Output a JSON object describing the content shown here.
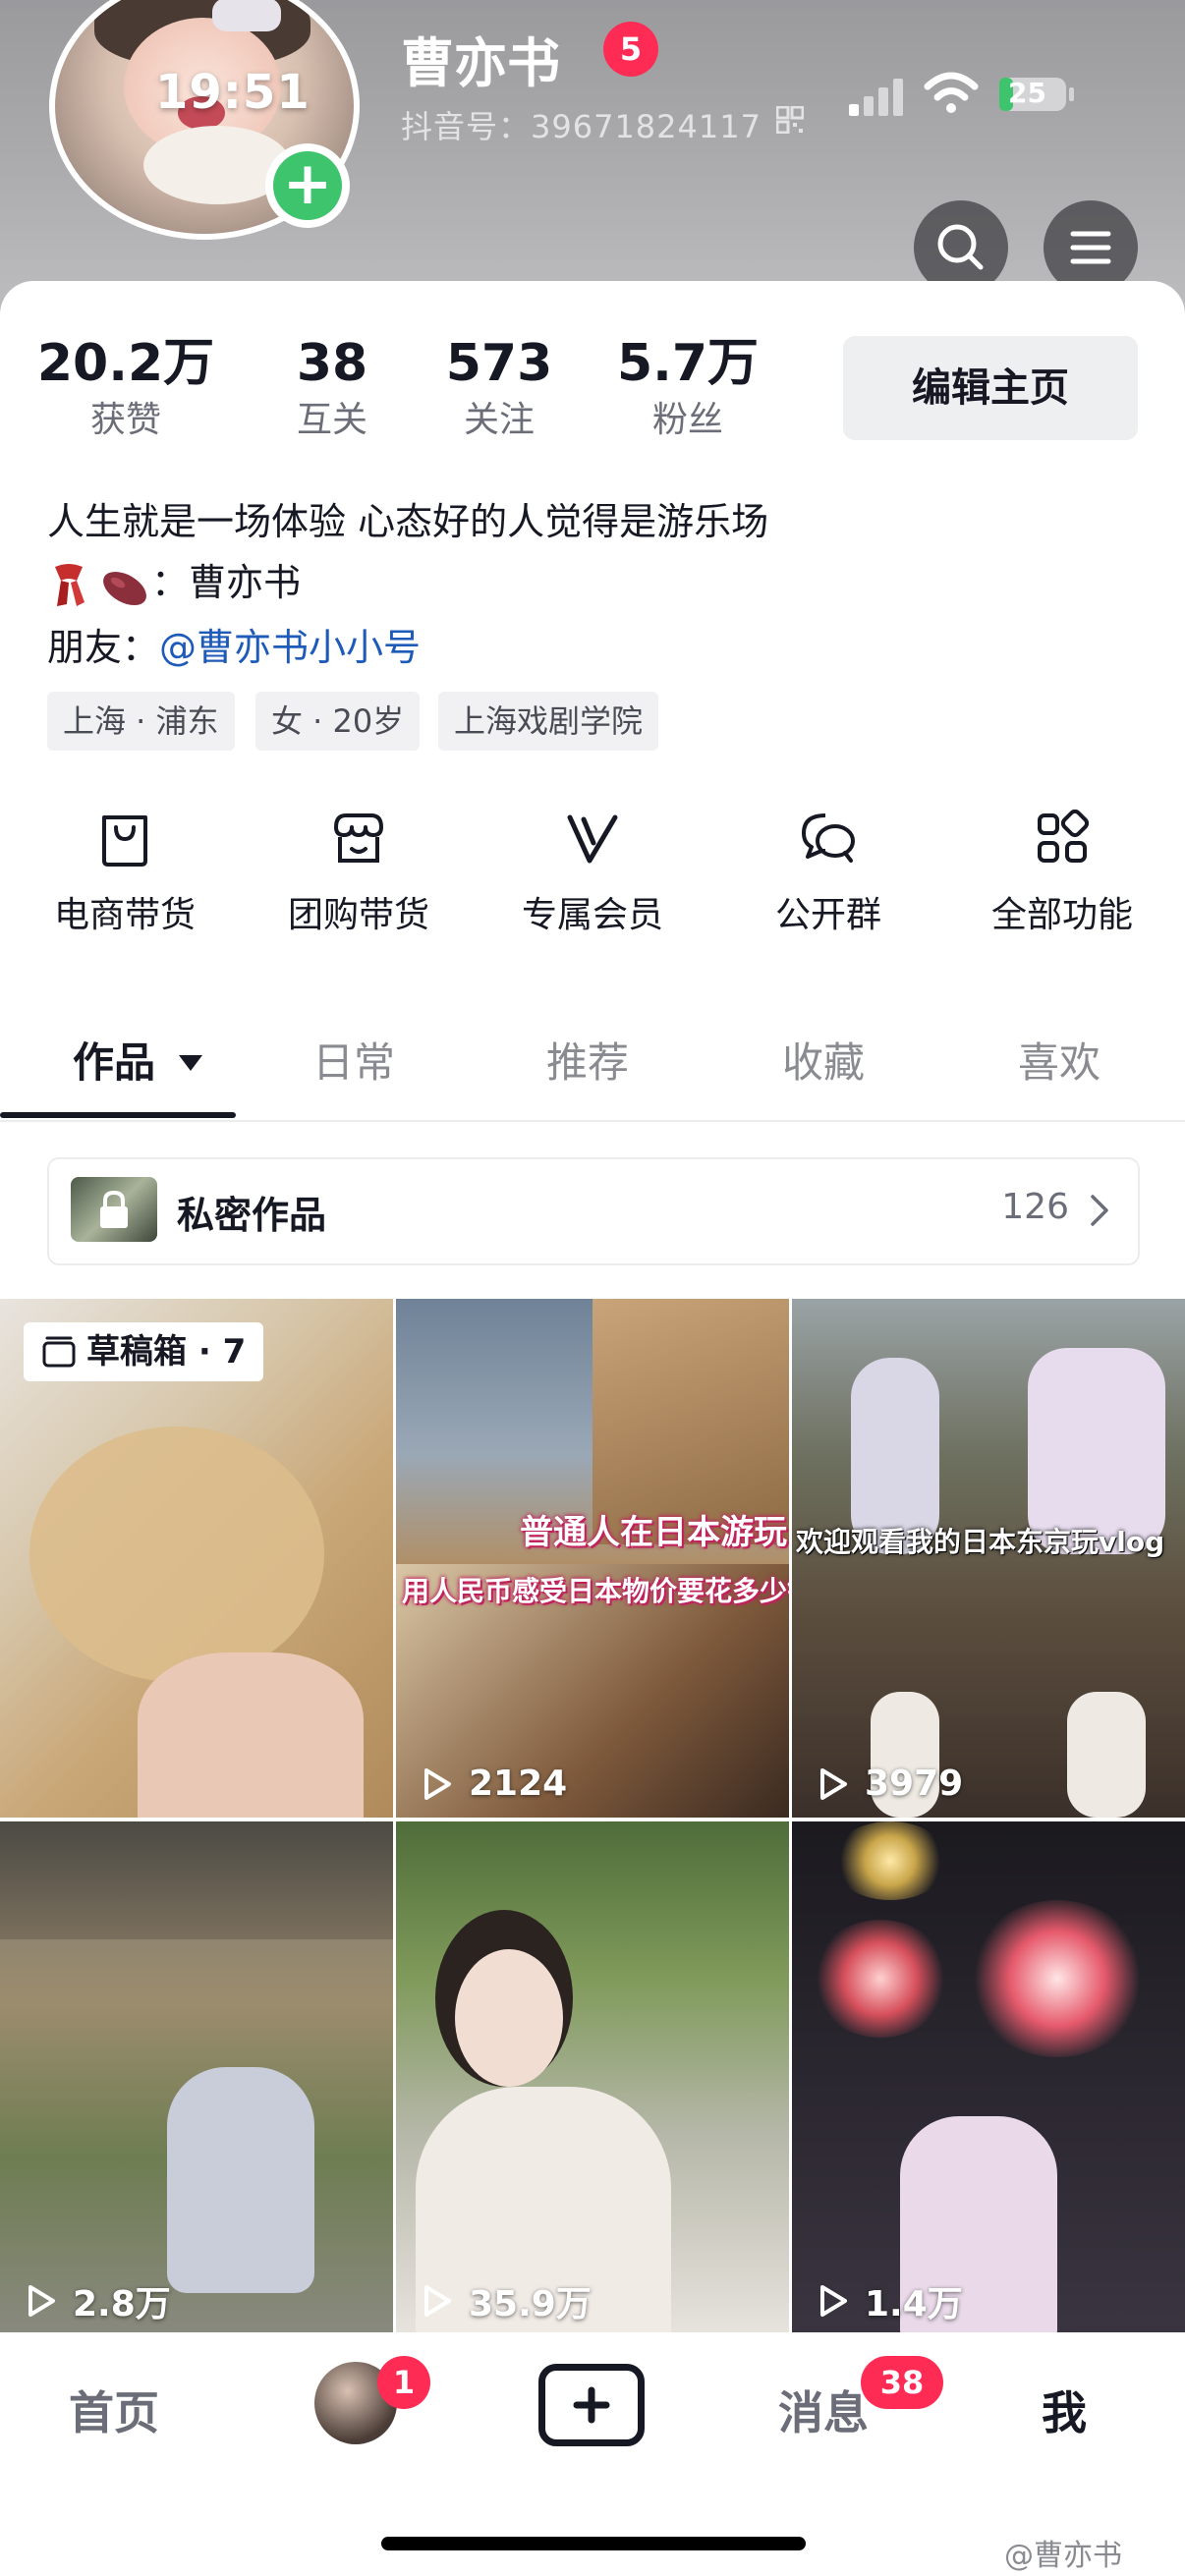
{
  "status_bar": {
    "time": "19:51",
    "battery": "25"
  },
  "profile": {
    "nickname": "曹亦书",
    "notification_count": "5",
    "douyin_id": "抖音号：39671824117"
  },
  "stats": [
    {
      "value": "20.2万",
      "label": "获赞"
    },
    {
      "value": "38",
      "label": "互关"
    },
    {
      "value": "573",
      "label": "关注"
    },
    {
      "value": "5.7万",
      "label": "粉丝"
    }
  ],
  "edit_profile_label": "编辑主页",
  "bio": {
    "line1": "人生就是一场体验 心态好的人觉得是游乐场",
    "line2_text": "：曹亦书",
    "friend_prefix": "朋友：",
    "friend_link": "@曹亦书小小号"
  },
  "tags": [
    "上海 · 浦东",
    "女 · 20岁",
    "上海戏剧学院"
  ],
  "features": [
    {
      "label": "电商带货",
      "icon": "shopping-bag-icon"
    },
    {
      "label": "团购带货",
      "icon": "store-icon"
    },
    {
      "label": "专属会员",
      "icon": "vip-v-icon"
    },
    {
      "label": "公开群",
      "icon": "chat-bubbles-icon"
    },
    {
      "label": "全部功能",
      "icon": "grid-apps-icon"
    }
  ],
  "tabs": [
    "作品",
    "日常",
    "推荐",
    "收藏",
    "喜欢"
  ],
  "private_works": {
    "label": "私密作品",
    "count": "126"
  },
  "grid": [
    {
      "draft": "草稿箱 · 7"
    },
    {
      "views": "2124",
      "caption1": "普通人在日本游玩",
      "caption2": "用人民币感受日本物价要花多少钱"
    },
    {
      "views": "3979",
      "caption1": "欢迎观看我的日本东京玩vlog"
    },
    {
      "views": "2.8万"
    },
    {
      "views": "35.9万"
    },
    {
      "views": "1.4万"
    }
  ],
  "bottom_nav": {
    "home": "首页",
    "friend_badge": "1",
    "messages": "消息",
    "messages_badge": "38",
    "me": "我"
  },
  "watermark": "@曹亦书",
  "colors": {
    "accent_red": "#fe2c55",
    "link_blue": "#1e5ab8",
    "add_green": "#3ec46d"
  }
}
